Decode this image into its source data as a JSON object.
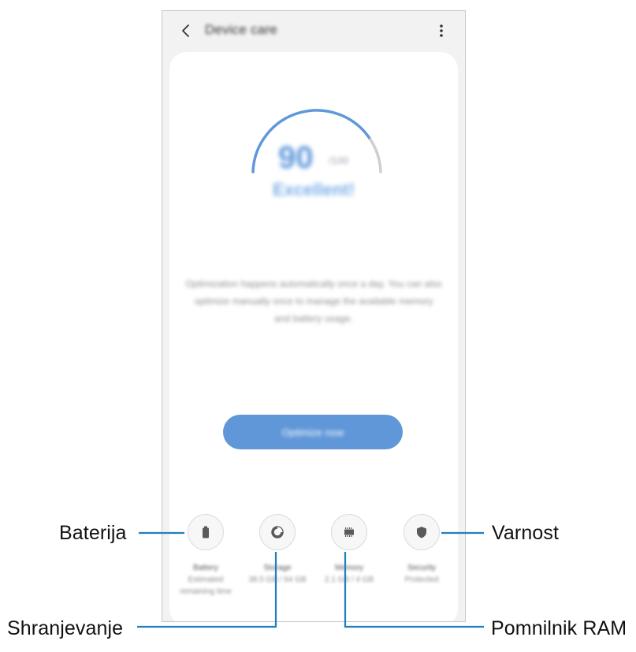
{
  "app": {
    "title": "Device care",
    "back_icon": "chevron-left-icon",
    "more_icon": "more-vertical-icon"
  },
  "status": {
    "score": "90",
    "score_unit": "/100",
    "label": "Excellent!",
    "description": "Optimization happens automatically once a day. You can also optimize manually once to manage the available memory and battery usage.",
    "accent_color": "#5f98da"
  },
  "optimize_button": {
    "label": "Optimize now"
  },
  "tiles": [
    {
      "name": "Battery",
      "value": "Estimated remaining time",
      "icon": "battery-icon"
    },
    {
      "name": "Storage",
      "value": "38.5 GB / 64 GB",
      "icon": "storage-icon"
    },
    {
      "name": "Memory",
      "value": "2.1 GB / 4 GB",
      "icon": "memory-icon"
    },
    {
      "name": "Security",
      "value": "Protected",
      "icon": "shield-icon"
    }
  ],
  "callouts": {
    "battery": "Baterija",
    "storage": "Shranjevanje",
    "memory": "Pomnilnik RAM",
    "security": "Varnost"
  },
  "colors": {
    "line": "#1f7fbf",
    "button": "#5f97d8",
    "icon": "#5a5a5a"
  }
}
